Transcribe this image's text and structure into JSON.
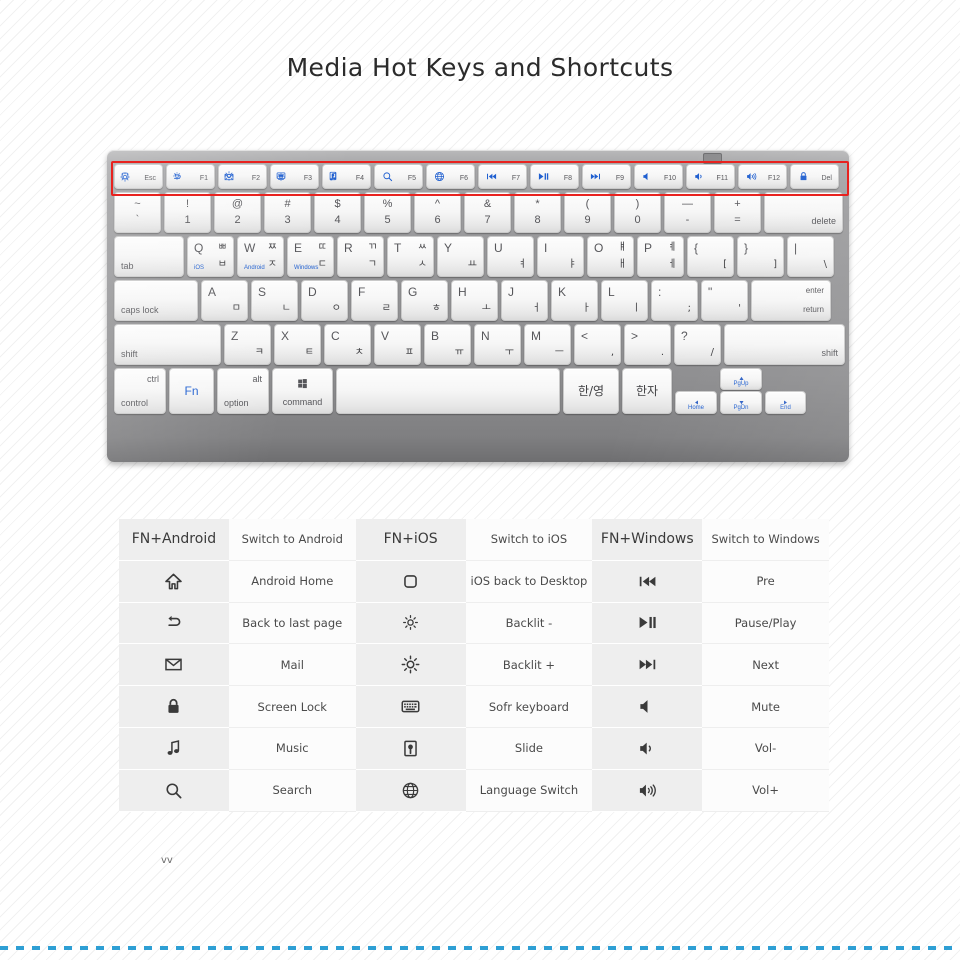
{
  "page": {
    "title": "Media Hot Keys and Shortcuts",
    "watermark": "vv",
    "accent_red": "#e8221f",
    "accent_blue": "#1f5fd0",
    "dots_blue": "#2e9fd4"
  },
  "keyboard": {
    "fn_row": [
      {
        "icon": "rounded-square-icon",
        "sub_icon": "brightness-up-icon",
        "label": "Esc"
      },
      {
        "icon": "brightness-low-icon",
        "sub_icon": "back-arrow-icon",
        "label": "F1"
      },
      {
        "icon": "brightness-icon",
        "sub_icon": "mail-icon",
        "label": "F2"
      },
      {
        "icon": "screen-icon",
        "sub_icon": "gear-icon",
        "label": "F3"
      },
      {
        "icon": "slide-icon",
        "sub_icon": "music-note-icon",
        "label": "F4"
      },
      {
        "icon": "search-icon",
        "label": "F5"
      },
      {
        "icon": "globe-icon",
        "label": "F6"
      },
      {
        "icon": "previous-track-icon",
        "label": "F7"
      },
      {
        "icon": "play-pause-icon",
        "label": "F8"
      },
      {
        "icon": "next-track-icon",
        "label": "F9"
      },
      {
        "icon": "mute-icon",
        "label": "F10"
      },
      {
        "icon": "volume-down-icon",
        "label": "F11"
      },
      {
        "icon": "volume-up-icon",
        "label": "F12"
      },
      {
        "icon": "lock-icon",
        "label": "Del"
      }
    ],
    "number_row": [
      {
        "top": "~",
        "bottom": "`"
      },
      {
        "top": "!",
        "bottom": "1"
      },
      {
        "top": "@",
        "bottom": "2"
      },
      {
        "top": "#",
        "bottom": "3"
      },
      {
        "top": "$",
        "bottom": "4"
      },
      {
        "top": "%",
        "bottom": "5"
      },
      {
        "top": "^",
        "bottom": "6"
      },
      {
        "top": "&",
        "bottom": "7"
      },
      {
        "top": "*",
        "bottom": "8"
      },
      {
        "top": "(",
        "bottom": "9"
      },
      {
        "top": ")",
        "bottom": "0"
      },
      {
        "top": "—",
        "bottom": "-"
      },
      {
        "top": "+",
        "bottom": "="
      },
      {
        "wide": "delete"
      }
    ],
    "qwerty_row": {
      "tab": "tab",
      "keys": [
        {
          "latin": "Q",
          "hangul_top": "ㅃ",
          "hangul_bottom": "ㅂ",
          "os": "iOS"
        },
        {
          "latin": "W",
          "hangul_top": "ㅉ",
          "hangul_bottom": "ㅈ",
          "os": "Android"
        },
        {
          "latin": "E",
          "hangul_top": "ㄸ",
          "hangul_bottom": "ㄷ",
          "os": "Windows"
        },
        {
          "latin": "R",
          "hangul_top": "ㄲ",
          "hangul_bottom": "ㄱ"
        },
        {
          "latin": "T",
          "hangul_top": "ㅆ",
          "hangul_bottom": "ㅅ"
        },
        {
          "latin": "Y",
          "hangul_bottom": "ㅛ"
        },
        {
          "latin": "U",
          "hangul_bottom": "ㅕ"
        },
        {
          "latin": "I",
          "hangul_bottom": "ㅑ"
        },
        {
          "latin": "O",
          "hangul_top": "ㅒ",
          "hangul_bottom": "ㅐ"
        },
        {
          "latin": "P",
          "hangul_top": "ㅖ",
          "hangul_bottom": "ㅔ"
        },
        {
          "latin": "{",
          "hangul_bottom": "["
        },
        {
          "latin": "}",
          "hangul_bottom": "]"
        },
        {
          "latin": "|",
          "hangul_bottom": "\\"
        }
      ]
    },
    "home_row": {
      "caps": "caps lock",
      "keys": [
        {
          "latin": "A",
          "hangul_bottom": "ㅁ"
        },
        {
          "latin": "S",
          "hangul_bottom": "ㄴ"
        },
        {
          "latin": "D",
          "hangul_bottom": "ㅇ"
        },
        {
          "latin": "F",
          "hangul_bottom": "ㄹ"
        },
        {
          "latin": "G",
          "hangul_bottom": "ㅎ"
        },
        {
          "latin": "H",
          "hangul_bottom": "ㅗ"
        },
        {
          "latin": "J",
          "hangul_bottom": "ㅓ"
        },
        {
          "latin": "K",
          "hangul_bottom": "ㅏ"
        },
        {
          "latin": "L",
          "hangul_bottom": "ㅣ"
        },
        {
          "latin": ":",
          "hangul_bottom": ";"
        },
        {
          "latin": "\"",
          "hangul_bottom": "'"
        }
      ],
      "enter_top": "enter",
      "enter_bottom": "return"
    },
    "shift_row": {
      "shift_left": "shift",
      "keys": [
        {
          "latin": "Z",
          "hangul_bottom": "ㅋ"
        },
        {
          "latin": "X",
          "hangul_bottom": "ㅌ"
        },
        {
          "latin": "C",
          "hangul_bottom": "ㅊ"
        },
        {
          "latin": "V",
          "hangul_bottom": "ㅍ"
        },
        {
          "latin": "B",
          "hangul_bottom": "ㅠ"
        },
        {
          "latin": "N",
          "hangul_bottom": "ㅜ"
        },
        {
          "latin": "M",
          "hangul_bottom": "ㅡ"
        },
        {
          "latin": "<",
          "hangul_bottom": ","
        },
        {
          "latin": ">",
          "hangul_bottom": "."
        },
        {
          "latin": "?",
          "hangul_bottom": "/"
        }
      ],
      "shift_right": "shift"
    },
    "bottom_row": {
      "ctrl_top": "ctrl",
      "ctrl_bottom": "control",
      "fn": "Fn",
      "alt_top": "alt",
      "alt_bottom": "option",
      "cmd_icon": "windows-icon",
      "cmd_bottom": "command",
      "space": "",
      "han_yeong": "한/영",
      "hanja": "한자",
      "arrow_left_icon": "arrow-left-icon",
      "arrow_left_label": "Home",
      "arrow_up_icon": "arrow-up-icon",
      "arrow_up_label": "PgUp",
      "arrow_down_icon": "arrow-down-icon",
      "arrow_down_label": "PgDn",
      "arrow_right_icon": "arrow-right-icon",
      "arrow_right_label": "End"
    }
  },
  "table": {
    "columns": [
      {
        "header_icon_text": "FN+Android",
        "header_label": "Switch to Android",
        "rows": [
          {
            "icon": "android-home-icon",
            "label": "Android Home"
          },
          {
            "icon": "back-arrow-icon",
            "label": "Back to last page"
          },
          {
            "icon": "mail-icon",
            "label": "Mail"
          },
          {
            "icon": "lock-icon",
            "label": "Screen Lock"
          },
          {
            "icon": "music-note-icon",
            "label": "Music"
          },
          {
            "icon": "search-icon",
            "label": "Search"
          }
        ]
      },
      {
        "header_icon_text": "FN+iOS",
        "header_label": "Switch to iOS",
        "rows": [
          {
            "icon": "rounded-square-icon",
            "label": "iOS back to Desktop"
          },
          {
            "icon": "brightness-down-icon",
            "label": "Backlit -"
          },
          {
            "icon": "brightness-up-icon",
            "label": "Backlit +"
          },
          {
            "icon": "keyboard-icon",
            "label": "Sofr keyboard"
          },
          {
            "icon": "slide-icon",
            "label": "Slide"
          },
          {
            "icon": "globe-icon",
            "label": "Language Switch"
          }
        ]
      },
      {
        "header_icon_text": "FN+Windows",
        "header_label": "Switch to Windows",
        "rows": [
          {
            "icon": "previous-track-icon",
            "label": "Pre"
          },
          {
            "icon": "play-pause-icon",
            "label": "Pause/Play"
          },
          {
            "icon": "next-track-icon",
            "label": "Next"
          },
          {
            "icon": "mute-icon",
            "label": "Mute"
          },
          {
            "icon": "volume-down-icon",
            "label": "Vol-"
          },
          {
            "icon": "volume-up-icon",
            "label": "Vol+"
          }
        ]
      }
    ]
  }
}
